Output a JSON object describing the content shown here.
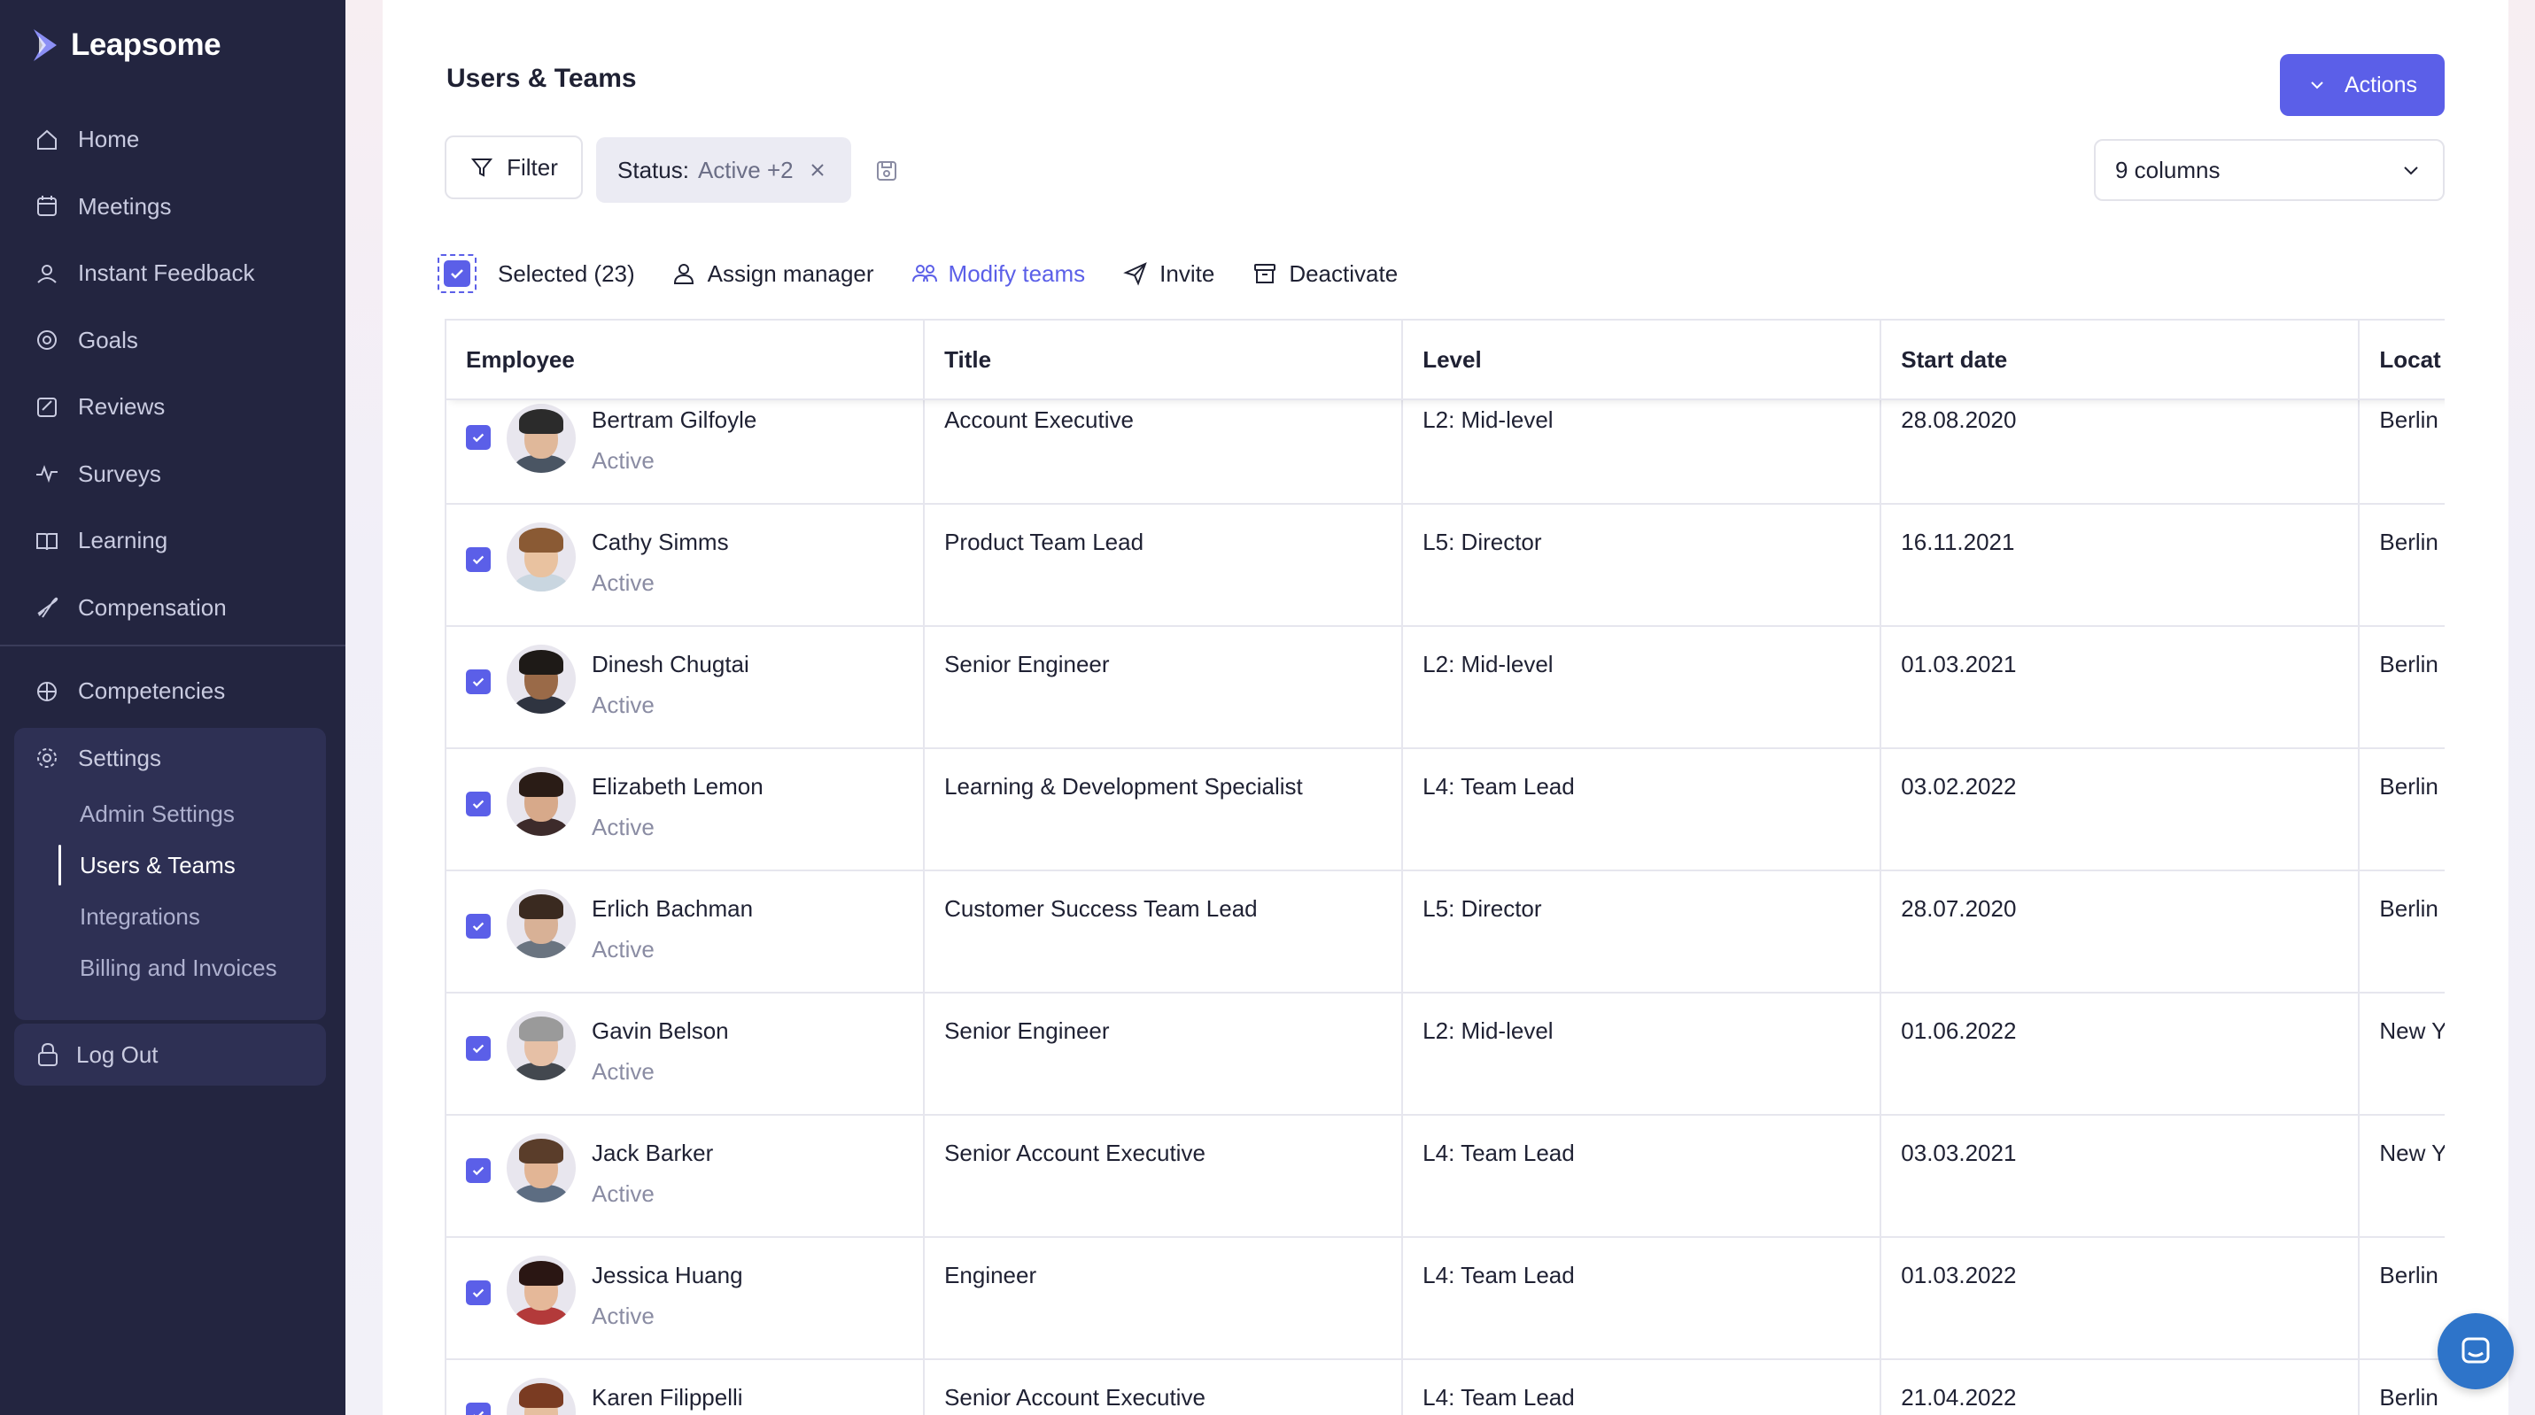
{
  "brand": {
    "name": "Leapsome"
  },
  "sidebar": {
    "items": [
      {
        "label": "Home",
        "icon": "home-icon"
      },
      {
        "label": "Meetings",
        "icon": "meetings-icon"
      },
      {
        "label": "Instant Feedback",
        "icon": "feedback-icon"
      },
      {
        "label": "Goals",
        "icon": "goals-icon"
      },
      {
        "label": "Reviews",
        "icon": "reviews-icon"
      },
      {
        "label": "Surveys",
        "icon": "surveys-icon"
      },
      {
        "label": "Learning",
        "icon": "learning-icon"
      },
      {
        "label": "Compensation",
        "icon": "compensation-icon"
      }
    ],
    "competencies": "Competencies",
    "settings": {
      "label": "Settings",
      "sub": [
        "Admin Settings",
        "Users & Teams",
        "Integrations",
        "Billing and Invoices"
      ],
      "active_index": 1
    },
    "logout": "Log Out"
  },
  "page": {
    "title": "Users & Teams",
    "actions_label": "Actions",
    "filter_label": "Filter",
    "status_chip": {
      "key": "Status:",
      "value": "Active +2"
    },
    "columns_select": "9 columns"
  },
  "bulk": {
    "selected": "Selected (23)",
    "assign_manager": "Assign manager",
    "modify_teams": "Modify teams",
    "invite": "Invite",
    "deactivate": "Deactivate"
  },
  "colors": {
    "accent": "#5b5fe8",
    "sidebar_bg": "#232540",
    "chat": "#2e74c9"
  },
  "table": {
    "headers": [
      "Employee",
      "Title",
      "Level",
      "Start date",
      "Locat"
    ],
    "rows": [
      {
        "name": "Bertram Gilfoyle",
        "status": "Active",
        "title": "Account Executive",
        "level": "L2: Mid-level",
        "start": "28.08.2020",
        "location": "Berlin"
      },
      {
        "name": "Cathy Simms",
        "status": "Active",
        "title": "Product Team Lead",
        "level": "L5: Director",
        "start": "16.11.2021",
        "location": "Berlin"
      },
      {
        "name": "Dinesh Chugtai",
        "status": "Active",
        "title": "Senior Engineer",
        "level": "L2: Mid-level",
        "start": "01.03.2021",
        "location": "Berlin"
      },
      {
        "name": "Elizabeth Lemon",
        "status": "Active",
        "title": "Learning & Development Specialist",
        "level": "L4: Team Lead",
        "start": "03.02.2022",
        "location": "Berlin"
      },
      {
        "name": "Erlich Bachman",
        "status": "Active",
        "title": "Customer Success Team Lead",
        "level": "L5: Director",
        "start": "28.07.2020",
        "location": "Berlin"
      },
      {
        "name": "Gavin Belson",
        "status": "Active",
        "title": "Senior Engineer",
        "level": "L2: Mid-level",
        "start": "01.06.2022",
        "location": "New Y"
      },
      {
        "name": "Jack Barker",
        "status": "Active",
        "title": "Senior Account Executive",
        "level": "L4: Team Lead",
        "start": "03.03.2021",
        "location": "New Y"
      },
      {
        "name": "Jessica Huang",
        "status": "Active",
        "title": "Engineer",
        "level": "L4: Team Lead",
        "start": "01.03.2022",
        "location": "Berlin"
      },
      {
        "name": "Karen Filippelli",
        "status": "",
        "title": "Senior Account Executive",
        "level": "L4: Team Lead",
        "start": "21.04.2022",
        "location": "Berlin"
      }
    ]
  }
}
